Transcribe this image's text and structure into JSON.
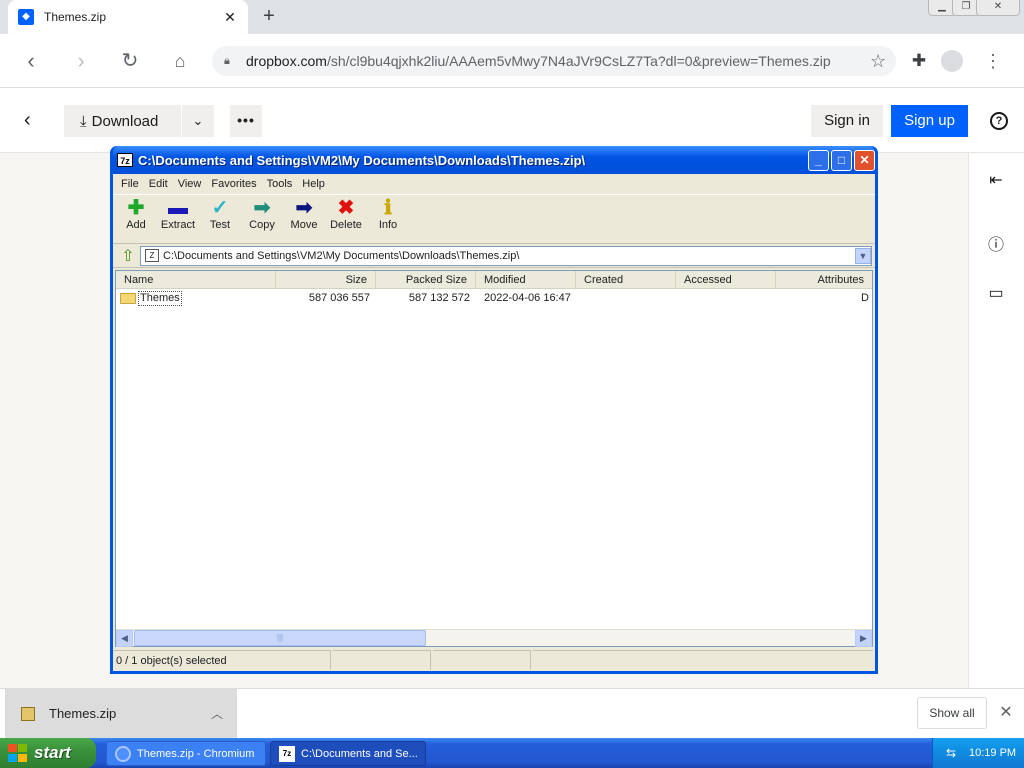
{
  "browser": {
    "tab_title": "Themes.zip",
    "tab_close": "✕",
    "new_tab": "+",
    "url_domain": "dropbox.com",
    "url_path": "/sh/cl9bu4qjxhk2liu/AAAem5vMwy7N4aJVr9CsLZ7Ta?dl=0&preview=Themes.zip"
  },
  "dropbox": {
    "download_label": "Download",
    "signin_label": "Sign in",
    "signup_label": "Sign up"
  },
  "sevenzip": {
    "title": "C:\\Documents and Settings\\VM2\\My Documents\\Downloads\\Themes.zip\\",
    "menu": [
      "File",
      "Edit",
      "View",
      "Favorites",
      "Tools",
      "Help"
    ],
    "tools": [
      {
        "label": "Add",
        "icon": "add-icon",
        "color": "#1fa82a"
      },
      {
        "label": "Extract",
        "icon": "extract-icon",
        "color": "#1a1ab8"
      },
      {
        "label": "Test",
        "icon": "test-icon",
        "color": "#2bb6c9"
      },
      {
        "label": "Copy",
        "icon": "copy-icon",
        "color": "#1f8f7c"
      },
      {
        "label": "Move",
        "icon": "move-icon",
        "color": "#0c1580"
      },
      {
        "label": "Delete",
        "icon": "delete-icon",
        "color": "#e01010"
      },
      {
        "label": "Info",
        "icon": "info-icon",
        "color": "#c9a600"
      }
    ],
    "address": "C:\\Documents and Settings\\VM2\\My Documents\\Downloads\\Themes.zip\\",
    "columns": [
      "Name",
      "Size",
      "Packed Size",
      "Modified",
      "Created",
      "Accessed",
      "Attributes"
    ],
    "rows": [
      {
        "name": "Themes",
        "size": "587 036 557",
        "packed": "587 132 572",
        "modified": "2022-04-06 16:47",
        "created": "",
        "accessed": "",
        "attributes": "D"
      }
    ],
    "status": "0 / 1 object(s) selected"
  },
  "downloads": {
    "item_name": "Themes.zip",
    "show_all": "Show all"
  },
  "taskbar": {
    "start_label": "start",
    "tasks": [
      "Themes.zip - Chromium",
      "C:\\Documents and Se..."
    ],
    "clock": "10:19 PM"
  }
}
